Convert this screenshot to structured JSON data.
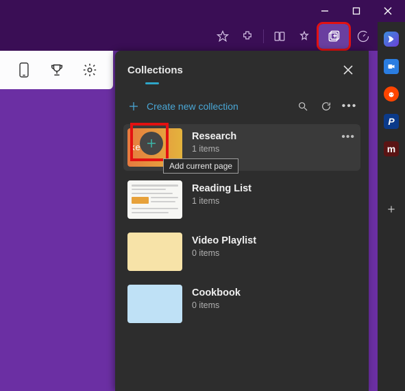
{
  "window": {
    "title": ""
  },
  "toolbar": {
    "icons": [
      "favorite-star",
      "extensions",
      "page-split",
      "favorites-collection",
      "collections",
      "performance"
    ]
  },
  "left_header": {
    "icons": [
      "phone-icon",
      "trophy-icon",
      "settings-gear-icon"
    ]
  },
  "panel": {
    "title": "Collections",
    "create_label": "Create new collection",
    "tooltip": "Add current page"
  },
  "collections": [
    {
      "name": "Research",
      "items": "1 items",
      "thumb": "research",
      "selected": true,
      "more": true
    },
    {
      "name": "Reading List",
      "items": "1 items",
      "thumb": "reading"
    },
    {
      "name": "Video Playlist",
      "items": "0 items",
      "thumb": "playlist"
    },
    {
      "name": "Cookbook",
      "items": "0 items",
      "thumb": "cookbook"
    }
  ],
  "right_sidebar": [
    {
      "name": "bing-chat-icon",
      "bg": "#1a6dd6",
      "glyph": ""
    },
    {
      "name": "meet-icon",
      "bg": "#2a7de1",
      "glyph": ""
    },
    {
      "name": "reddit-icon",
      "bg": "#ff4500",
      "glyph": ""
    },
    {
      "name": "paypal-icon",
      "bg": "#0b3a8a",
      "glyph": "P"
    },
    {
      "name": "m-icon",
      "bg": "#5a1414",
      "glyph": "m"
    }
  ]
}
